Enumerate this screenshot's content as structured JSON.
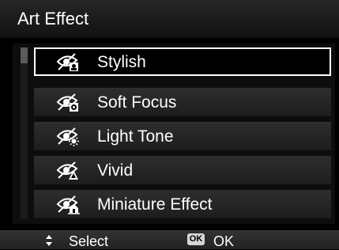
{
  "window": {
    "title": "Art Effect"
  },
  "menu": {
    "items": [
      {
        "label": "Stylish",
        "icon": "art-effect-stylish-icon",
        "selected": true
      },
      {
        "label": "Soft Focus",
        "icon": "art-effect-soft-focus-icon",
        "selected": false
      },
      {
        "label": "Light Tone",
        "icon": "art-effect-light-tone-icon",
        "selected": false
      },
      {
        "label": "Vivid",
        "icon": "art-effect-vivid-icon",
        "selected": false
      },
      {
        "label": "Miniature Effect",
        "icon": "art-effect-miniature-icon",
        "selected": false
      }
    ]
  },
  "footer": {
    "select_label": "Select",
    "ok_badge": "OK",
    "ok_label": "OK"
  },
  "colors": {
    "background": "#000000",
    "title_bar": "#1c1c1c",
    "item_bg": "#262626",
    "selection_border": "#ffffff",
    "text": "#ffffff"
  }
}
